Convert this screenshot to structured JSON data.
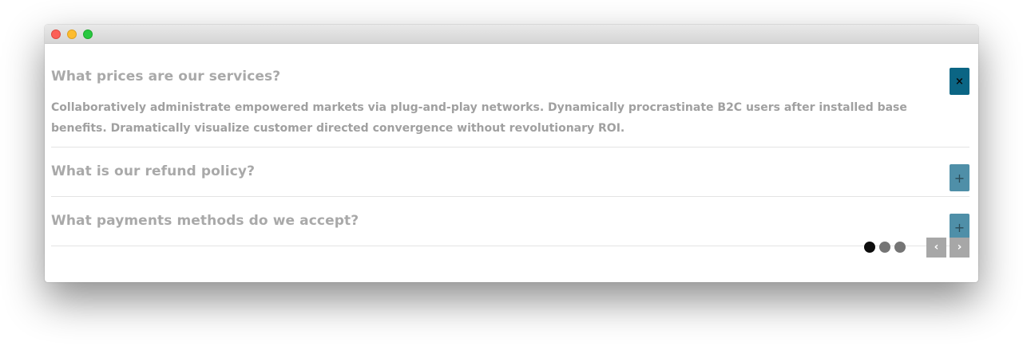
{
  "faq": {
    "items": [
      {
        "question": "What prices are our services?",
        "answer": "Collaboratively administrate empowered markets via plug-and-play networks. Dynamically procrastinate B2C users after installed base benefits. Dramatically visualize customer directed convergence without revolutionary ROI.",
        "expanded": true,
        "toggle_symbol": "×"
      },
      {
        "question": "What is our refund policy?",
        "expanded": false,
        "toggle_symbol": "+"
      },
      {
        "question": "What payments methods do we accept?",
        "expanded": false,
        "toggle_symbol": "+"
      }
    ]
  },
  "pagination": {
    "pages": 3,
    "current_page": 1,
    "prev_symbol": "‹",
    "next_symbol": "›"
  },
  "colors": {
    "active_toggle": "#0b6584",
    "inactive_toggle": "#4f8fa8",
    "text": "#a9a9a9",
    "nav_button": "#a7a7a7"
  },
  "icons": {
    "collapse": "close-icon",
    "expand": "plus-icon",
    "prev": "chevron-left-icon",
    "next": "chevron-right-icon"
  }
}
